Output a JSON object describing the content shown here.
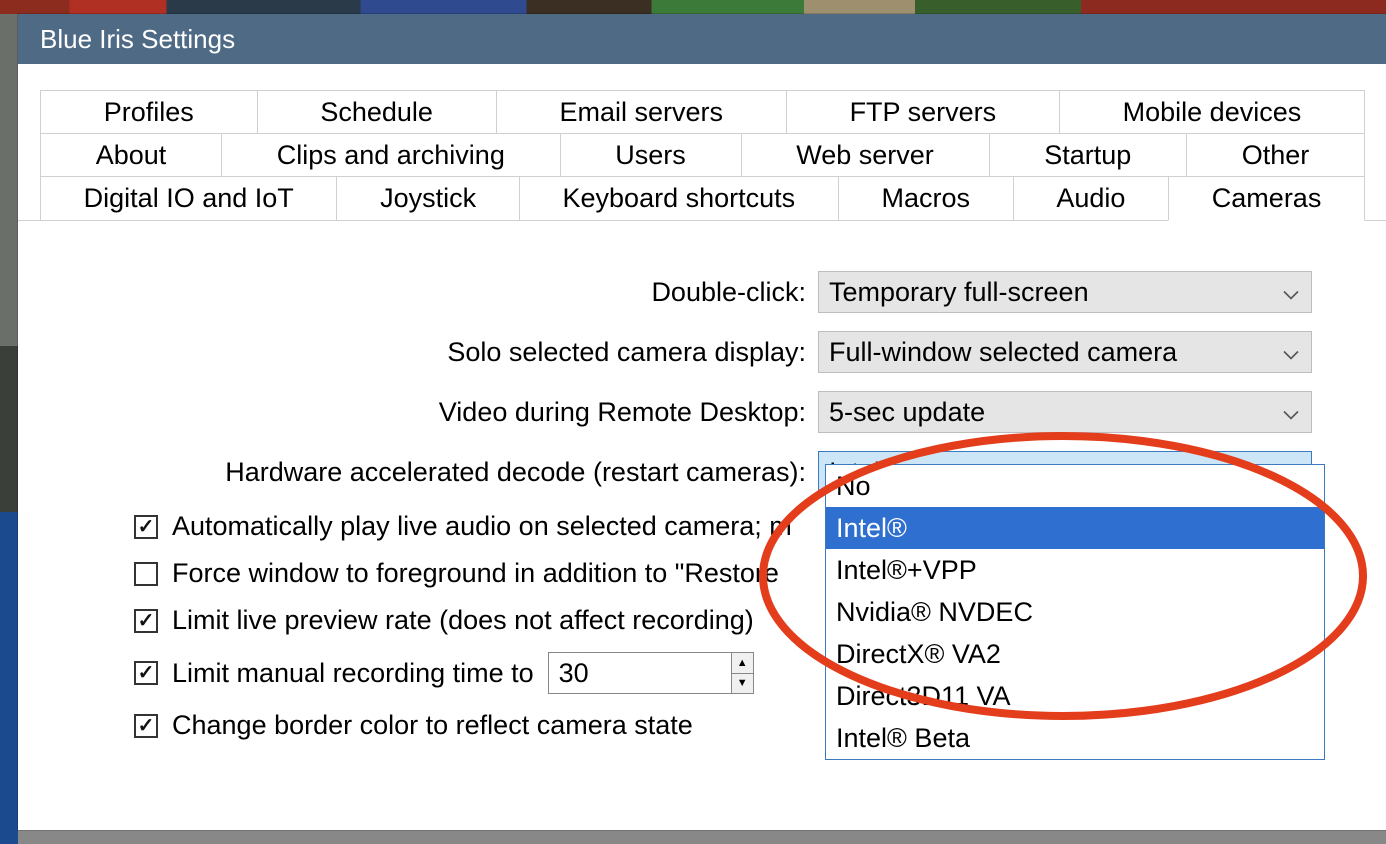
{
  "titlebar": {
    "text": "Blue Iris Settings"
  },
  "tabs": {
    "row1": [
      "Profiles",
      "Schedule",
      "Email servers",
      "FTP servers",
      "Mobile devices"
    ],
    "row2": [
      "About",
      "Clips and archiving",
      "Users",
      "Web server",
      "Startup",
      "Other"
    ],
    "row3": [
      "Digital IO and IoT",
      "Joystick",
      "Keyboard shortcuts",
      "Macros",
      "Audio",
      "Cameras"
    ],
    "active": "Cameras"
  },
  "settings": {
    "double_click": {
      "label": "Double-click:",
      "value": "Temporary full-screen"
    },
    "solo_display": {
      "label": "Solo selected camera display:",
      "value": "Full-window selected camera"
    },
    "remote_desktop": {
      "label": "Video during Remote Desktop:",
      "value": "5-sec update"
    },
    "hw_decode": {
      "label": "Hardware accelerated decode (restart cameras):",
      "value": "Intel®",
      "options": [
        "No",
        "Intel®",
        "Intel®+VPP",
        "Nvidia® NVDEC",
        "DirectX® VA2",
        "Direct3D11 VA",
        "Intel® Beta"
      ],
      "selected_index": 1
    }
  },
  "checkboxes": {
    "auto_audio": {
      "label": "Automatically play live audio on selected camera; m",
      "checked": true
    },
    "force_fg": {
      "label": "Force window to foreground in addition to \"Restore",
      "checked": false
    },
    "limit_preview": {
      "label": "Limit live preview rate (does not affect recording)",
      "checked": true
    },
    "limit_record": {
      "label": "Limit manual recording time to",
      "checked": true,
      "spinner_value": "30"
    },
    "change_border": {
      "label": "Change border color to reflect camera state",
      "checked": true
    }
  }
}
